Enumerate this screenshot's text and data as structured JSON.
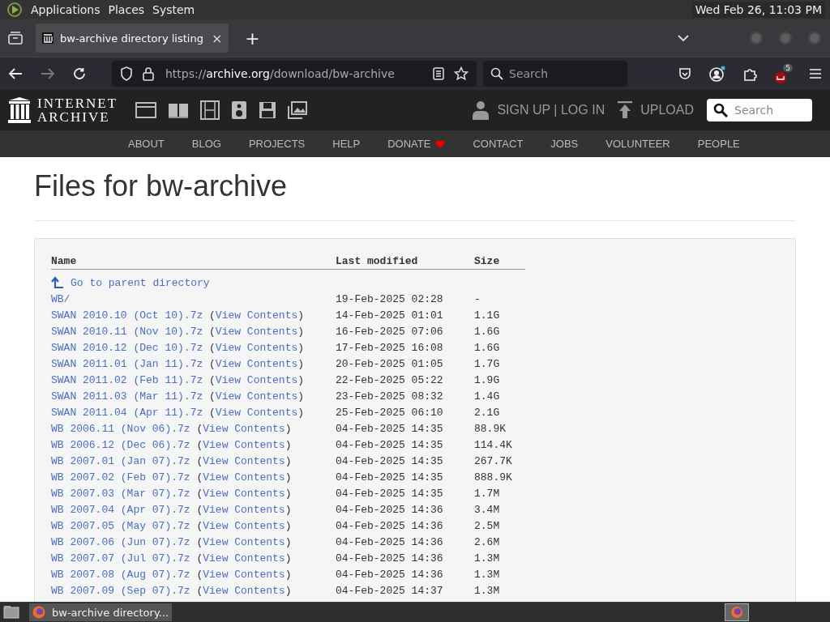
{
  "top_panel": {
    "menus": [
      "Applications",
      "Places",
      "System"
    ],
    "clock": "Wed Feb 26, 11:03 PM"
  },
  "tabs": [
    {
      "label": "bw-archive directory listing",
      "selected": true,
      "close": "×"
    }
  ],
  "new_tab": "+",
  "address_bar": {
    "scheme": "https://",
    "domain": "archive.org",
    "path": "/download/bw-archive"
  },
  "browser_search": {
    "placeholder": "Search"
  },
  "extension_badge": "5",
  "site_header": {
    "logo_line1": "INTERNET",
    "logo_line2": "ARCHIVE",
    "account": "SIGN UP | LOG IN",
    "upload": "UPLOAD",
    "search_placeholder": "Search"
  },
  "site_nav": [
    {
      "label": "ABOUT"
    },
    {
      "label": "BLOG"
    },
    {
      "label": "PROJECTS"
    },
    {
      "label": "HELP"
    },
    {
      "label": "DONATE",
      "heart": true
    },
    {
      "label": "CONTACT"
    },
    {
      "label": "JOBS"
    },
    {
      "label": "VOLUNTEER"
    },
    {
      "label": "PEOPLE"
    }
  ],
  "page_title": "Files for bw-archive",
  "table": {
    "columns": [
      "Name",
      "Last modified",
      "Size"
    ],
    "parent_link": "Go to parent directory",
    "rows": [
      {
        "name": "WB/",
        "modified": "19-Feb-2025 02:28",
        "size": "-"
      },
      {
        "name": "SWAN 2010.10 (Oct 10).7z",
        "view": {
          "open": "(",
          "label": "View Contents",
          "close": ")"
        },
        "modified": "14-Feb-2025 01:01",
        "size": "1.1G"
      },
      {
        "name": "SWAN 2010.11 (Nov 10).7z",
        "view": {
          "open": "(",
          "label": "View Contents",
          "close": ")"
        },
        "modified": "16-Feb-2025 07:06",
        "size": "1.6G"
      },
      {
        "name": "SWAN 2010.12 (Dec 10).7z",
        "view": {
          "open": "(",
          "label": "View Contents",
          "close": ")"
        },
        "modified": "17-Feb-2025 16:08",
        "size": "1.6G"
      },
      {
        "name": "SWAN 2011.01 (Jan 11).7z",
        "view": {
          "open": "(",
          "label": "View Contents",
          "close": ")"
        },
        "modified": "20-Feb-2025 01:05",
        "size": "1.7G"
      },
      {
        "name": "SWAN 2011.02 (Feb 11).7z",
        "view": {
          "open": "(",
          "label": "View Contents",
          "close": ")"
        },
        "modified": "22-Feb-2025 05:22",
        "size": "1.9G"
      },
      {
        "name": "SWAN 2011.03 (Mar 11).7z",
        "view": {
          "open": "(",
          "label": "View Contents",
          "close": ")"
        },
        "modified": "23-Feb-2025 08:32",
        "size": "1.4G"
      },
      {
        "name": "SWAN 2011.04 (Apr 11).7z",
        "view": {
          "open": "(",
          "label": "View Contents",
          "close": ")"
        },
        "modified": "25-Feb-2025 06:10",
        "size": "2.1G"
      },
      {
        "name": "WB 2006.11 (Nov 06).7z",
        "view": {
          "open": "(",
          "label": "View Contents",
          "close": ")"
        },
        "modified": "04-Feb-2025 14:35",
        "size": "88.9K"
      },
      {
        "name": "WB 2006.12 (Dec 06).7z",
        "view": {
          "open": "(",
          "label": "View Contents",
          "close": ")"
        },
        "modified": "04-Feb-2025 14:35",
        "size": "114.4K"
      },
      {
        "name": "WB 2007.01 (Jan 07).7z",
        "view": {
          "open": "(",
          "label": "View Contents",
          "close": ")"
        },
        "modified": "04-Feb-2025 14:35",
        "size": "267.7K"
      },
      {
        "name": "WB 2007.02 (Feb 07).7z",
        "view": {
          "open": "(",
          "label": "View Contents",
          "close": ")"
        },
        "modified": "04-Feb-2025 14:35",
        "size": "888.9K"
      },
      {
        "name": "WB 2007.03 (Mar 07).7z",
        "view": {
          "open": "(",
          "label": "View Contents",
          "close": ")"
        },
        "modified": "04-Feb-2025 14:35",
        "size": "1.7M"
      },
      {
        "name": "WB 2007.04 (Apr 07).7z",
        "view": {
          "open": "(",
          "label": "View Contents",
          "close": ")"
        },
        "modified": "04-Feb-2025 14:36",
        "size": "3.4M"
      },
      {
        "name": "WB 2007.05 (May 07).7z",
        "view": {
          "open": "(",
          "label": "View Contents",
          "close": ")"
        },
        "modified": "04-Feb-2025 14:36",
        "size": "2.5M"
      },
      {
        "name": "WB 2007.06 (Jun 07).7z",
        "view": {
          "open": "(",
          "label": "View Contents",
          "close": ")"
        },
        "modified": "04-Feb-2025 14:36",
        "size": "2.6M"
      },
      {
        "name": "WB 2007.07 (Jul 07).7z",
        "view": {
          "open": "(",
          "label": "View Contents",
          "close": ")"
        },
        "modified": "04-Feb-2025 14:36",
        "size": "1.3M"
      },
      {
        "name": "WB 2007.08 (Aug 07).7z",
        "view": {
          "open": "(",
          "label": "View Contents",
          "close": ")"
        },
        "modified": "04-Feb-2025 14:36",
        "size": "1.3M"
      },
      {
        "name": "WB 2007.09 (Sep 07).7z",
        "view": {
          "open": "(",
          "label": "View Contents",
          "close": ")"
        },
        "modified": "04-Feb-2025 14:37",
        "size": "1.3M"
      }
    ]
  },
  "taskbar": {
    "windows": [
      {
        "label": "bw-archive directory...",
        "selected": true
      }
    ]
  }
}
